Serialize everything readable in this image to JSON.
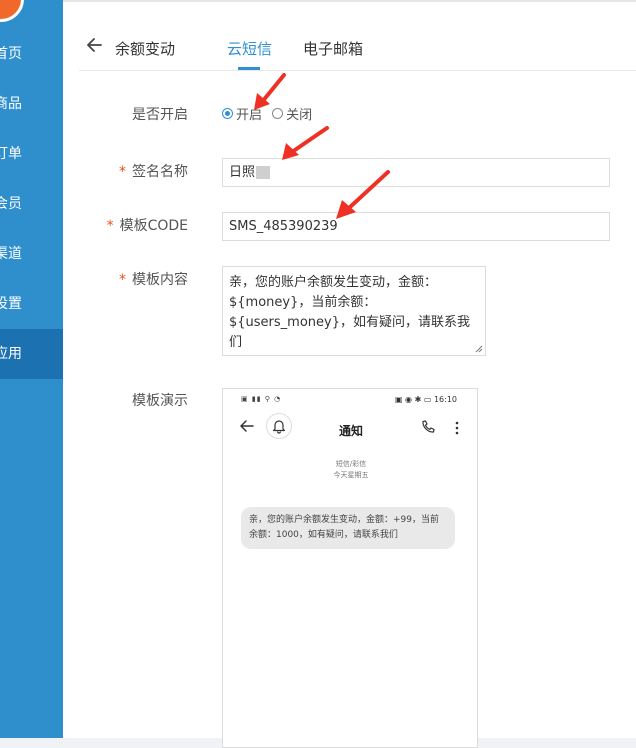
{
  "sidebar": {
    "items": [
      {
        "label": "首页"
      },
      {
        "label": "商品"
      },
      {
        "label": "订单"
      },
      {
        "label": "会员"
      },
      {
        "label": "渠道"
      },
      {
        "label": "设置"
      },
      {
        "label": "应用"
      }
    ],
    "active_index": 6,
    "colors": {
      "bg": "#2f8fcd",
      "active": "#1c72b0",
      "logo": "#f0682a"
    }
  },
  "header": {
    "title": "余额变动",
    "tabs": [
      {
        "label": "云短信",
        "active": true
      },
      {
        "label": "电子邮箱",
        "active": false
      }
    ],
    "accent_color": "#2e8fd1"
  },
  "form": {
    "enable": {
      "label": "是否开启",
      "options": [
        {
          "label": "开启",
          "checked": true
        },
        {
          "label": "关闭",
          "checked": false
        }
      ]
    },
    "sign_name": {
      "label": "签名名称",
      "value": "日照"
    },
    "template_code": {
      "label": "模板CODE",
      "value": "SMS_485390239"
    },
    "template_content": {
      "label": "模板内容",
      "value": "亲，您的账户余额发生变动，金额：${money}，当前余额：${users_money}，如有疑问，请联系我们"
    },
    "preview": {
      "label": "模板演示",
      "status_time": "16:10",
      "title": "通知",
      "message_type": "短信/彩信",
      "date": "今天星期五",
      "message": "亲，您的账户余额发生变动，金额：+99，当前余额：1000，如有疑问，请联系我们"
    }
  },
  "required_marker": "*"
}
